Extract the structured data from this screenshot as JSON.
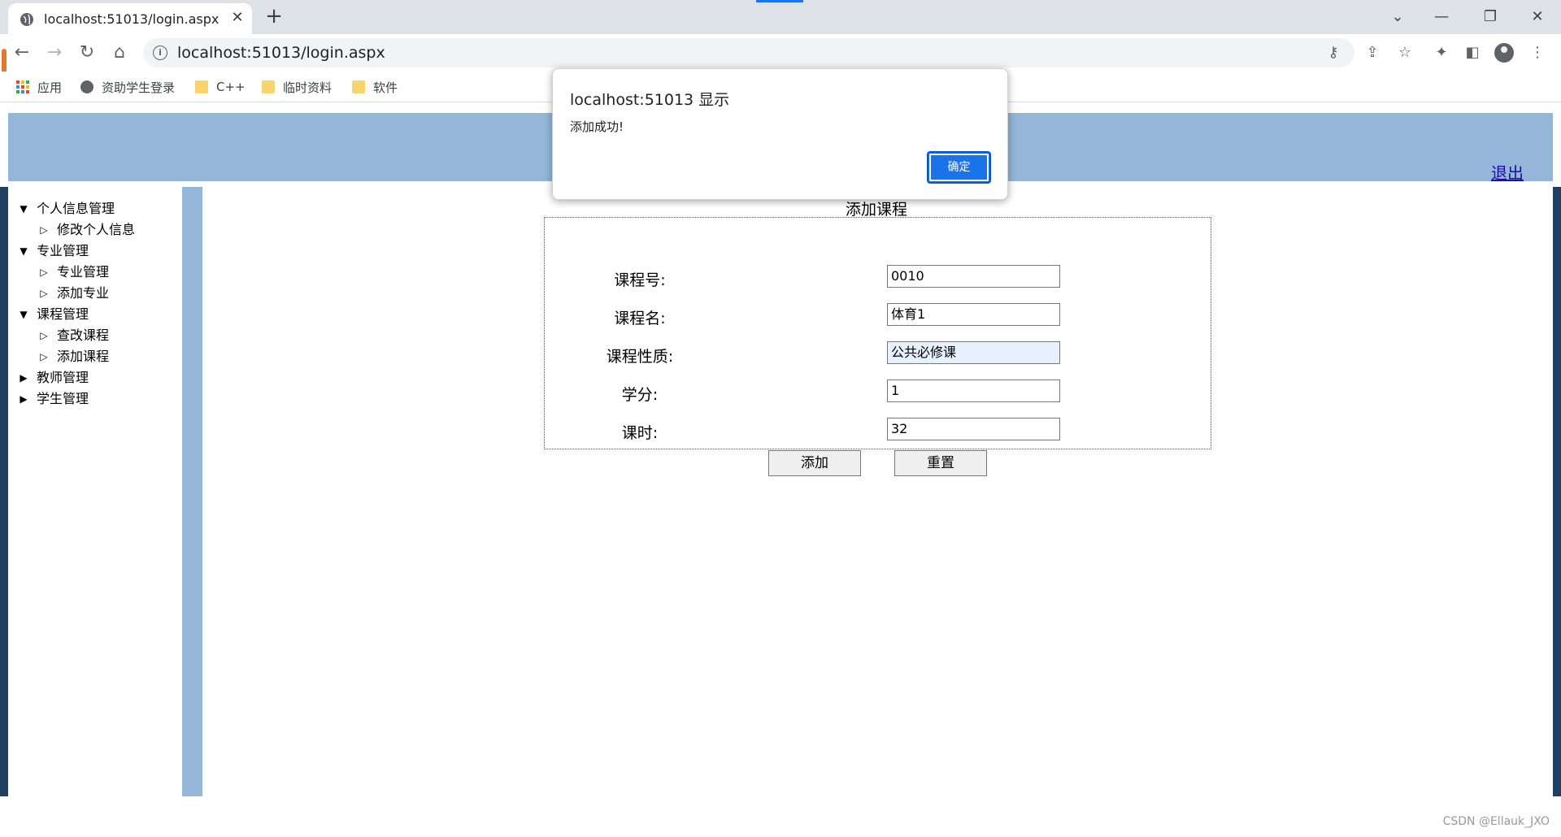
{
  "browser": {
    "tab_title": "localhost:51013/login.aspx",
    "url": "localhost:51013/login.aspx",
    "new_tab_symbol": "+",
    "close_symbol": "✕",
    "bookmarks": [
      {
        "label": "应用",
        "icon": "apps-icon"
      },
      {
        "label": "资助学生登录",
        "icon": "globe-icon"
      },
      {
        "label": "C++",
        "icon": "folder-icon"
      },
      {
        "label": "临时资料",
        "icon": "folder-icon"
      },
      {
        "label": "软件",
        "icon": "folder-icon"
      }
    ]
  },
  "header": {
    "logout_label": "退出",
    "color": "#94b6d8"
  },
  "tree": [
    {
      "label": "个人信息管理",
      "expanded": true,
      "level": 0
    },
    {
      "label": "修改个人信息",
      "level": 1
    },
    {
      "label": "专业管理",
      "expanded": true,
      "level": 0
    },
    {
      "label": "专业管理",
      "level": 1
    },
    {
      "label": "添加专业",
      "level": 1
    },
    {
      "label": "课程管理",
      "expanded": true,
      "level": 0
    },
    {
      "label": "查改课程",
      "level": 1
    },
    {
      "label": "添加课程",
      "level": 1
    },
    {
      "label": "教师管理",
      "expanded": false,
      "level": 0
    },
    {
      "label": "学生管理",
      "expanded": false,
      "level": 0
    }
  ],
  "form": {
    "caption": "添加课程",
    "fields": [
      {
        "label": "课程号:",
        "value": "0010"
      },
      {
        "label": "课程名:",
        "value": "体育1"
      },
      {
        "label": "课程性质:",
        "value": "公共必修课"
      },
      {
        "label": "学分:",
        "value": "1"
      },
      {
        "label": "课时:",
        "value": "32"
      }
    ],
    "add_label": "添加",
    "reset_label": "重置"
  },
  "dialog": {
    "title": "localhost:51013 显示",
    "message": "添加成功!",
    "ok_label": "确定"
  },
  "watermark": "CSDN @Ellauk_JXO",
  "colors": {
    "accent": "#1a73e8",
    "sidebar_dark": "#1f3f63",
    "header_blue": "#94b6d8"
  }
}
